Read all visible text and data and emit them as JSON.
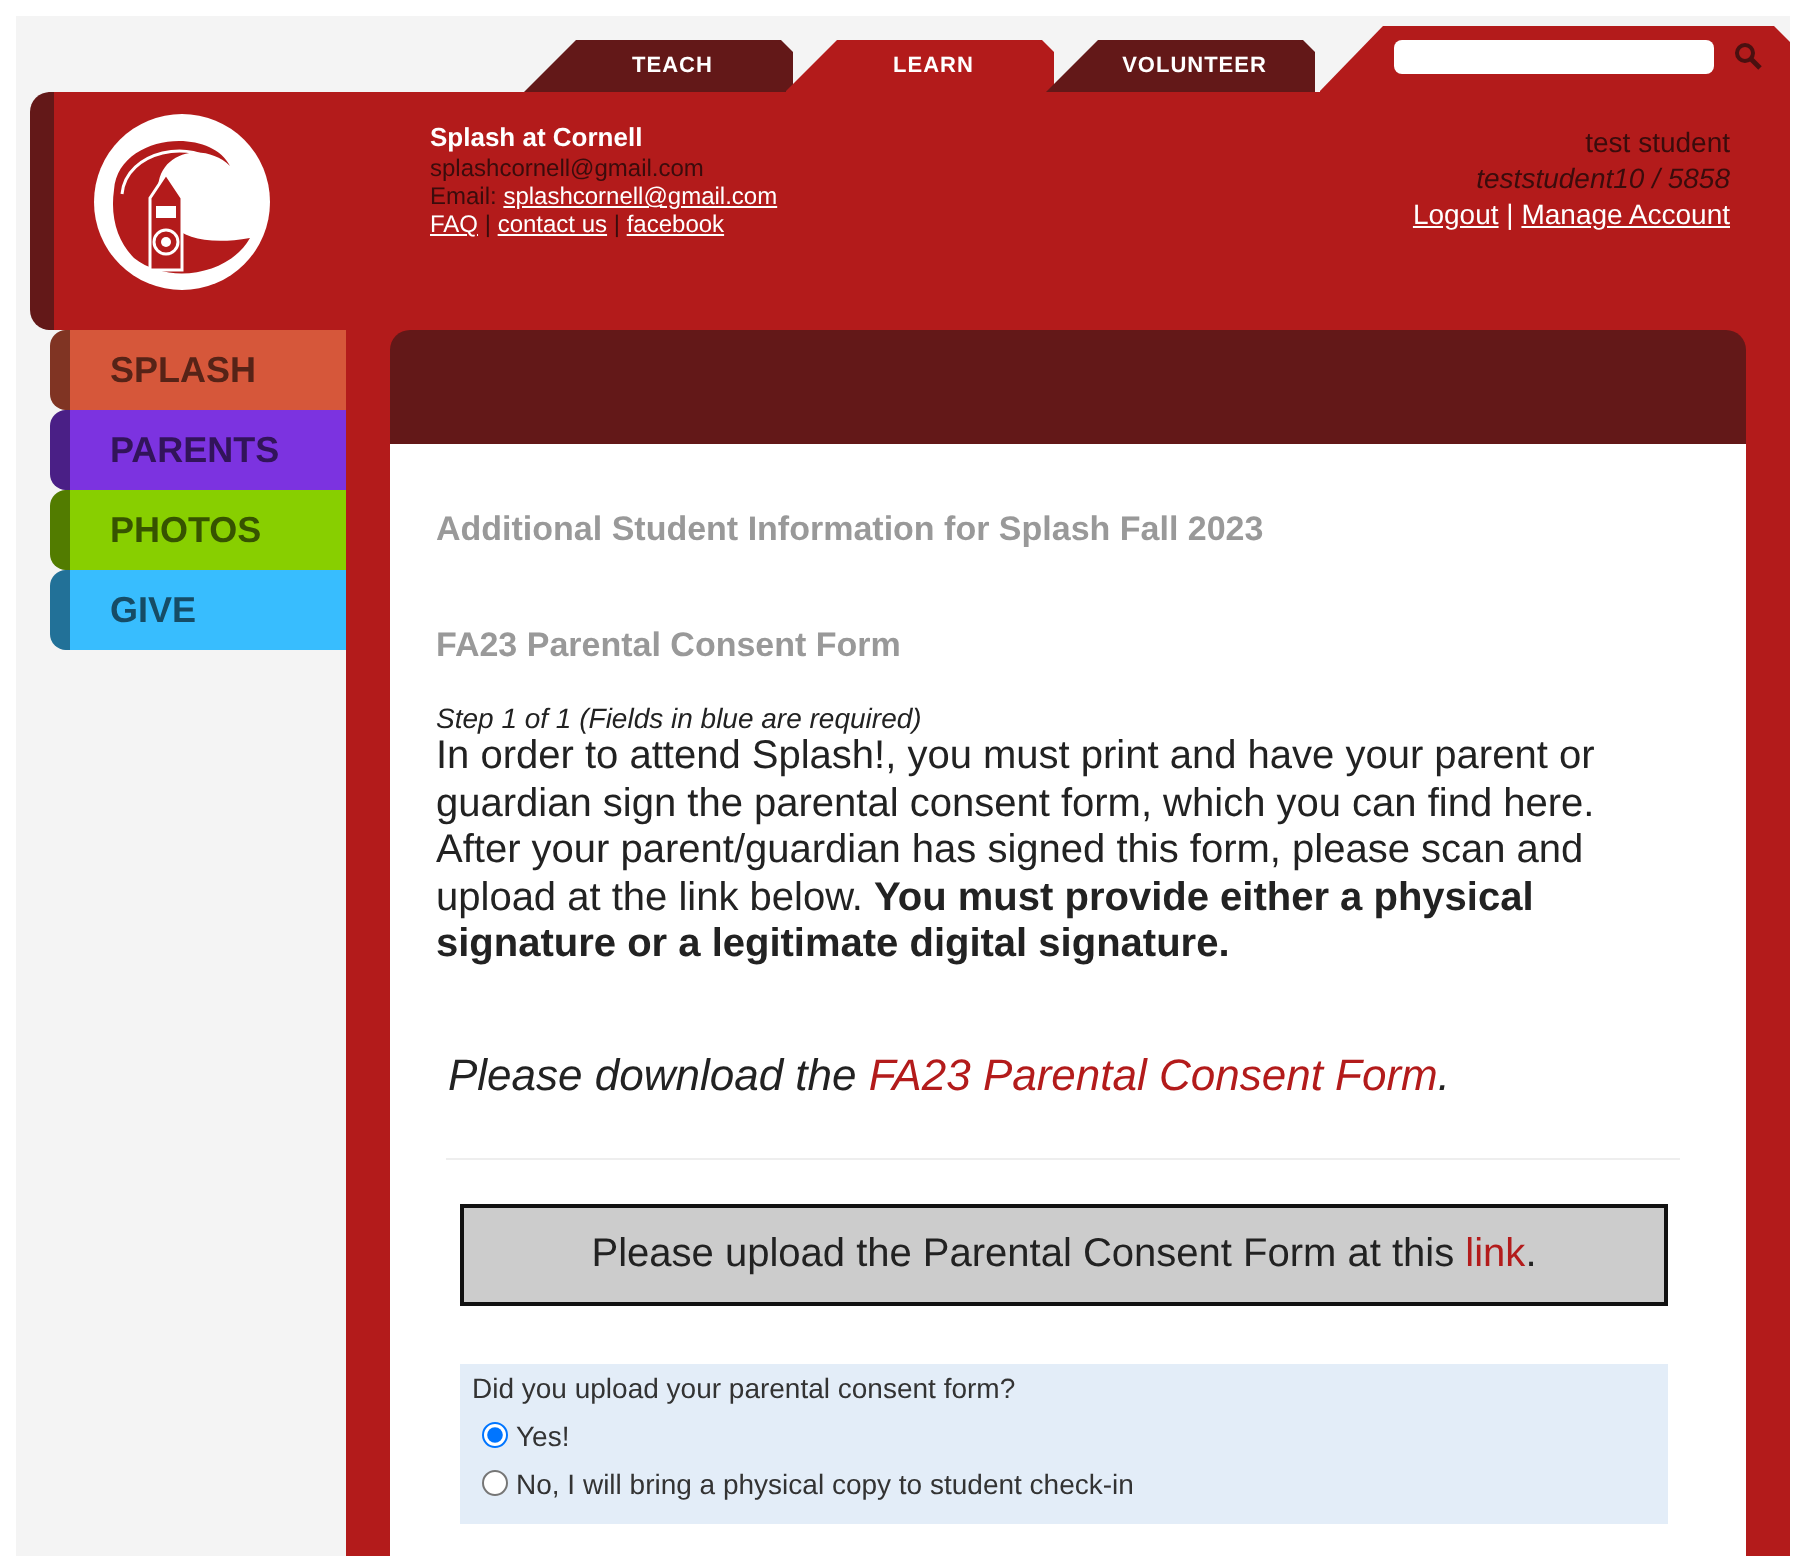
{
  "top_tabs": [
    {
      "label": "TEACH",
      "selected": false
    },
    {
      "label": "LEARN",
      "selected": true
    },
    {
      "label": "VOLUNTEER",
      "selected": false
    }
  ],
  "site": {
    "title": "Splash at Cornell",
    "email_plain": "splashcornell@gmail.com",
    "email_label": "Email:",
    "email_link": "splashcornell@gmail.com",
    "links": [
      "FAQ",
      "contact us",
      "facebook"
    ],
    "separator": "|"
  },
  "user": {
    "name": "test student",
    "account": "teststudent10 / 5858",
    "links": [
      "Logout",
      "Manage Account"
    ],
    "separator": "|"
  },
  "sidebar": {
    "items": [
      {
        "label": "SPLASH",
        "color": "#d6573a"
      },
      {
        "label": "PARENTS",
        "color": "#7c33e0"
      },
      {
        "label": "PHOTOS",
        "color": "#88cf00"
      },
      {
        "label": "GIVE",
        "color": "#38bdfe"
      }
    ]
  },
  "content": {
    "heading": "Additional Student Information for Splash Fall 2023",
    "form_title": "FA23 Parental Consent Form",
    "step": "Step 1 of 1 (Fields in blue are required)",
    "instructions": "In order to attend Splash!, you must print and have your parent or guardian sign the parental consent form, which you can find here. After your parent/guardian has signed this form, please scan and upload at the link below. **You must provide either a physical signature or a legitimate digital signature.**",
    "download": {
      "before": "Please download the ",
      "link": "FA23 Parental Consent Form",
      "after": "."
    },
    "upload": {
      "before": "Please upload the Parental Consent Form at this ",
      "link": "link",
      "after": "."
    },
    "question": {
      "label": "Did you upload your parental consent form?",
      "options": [
        {
          "label": "Yes!",
          "selected": true
        },
        {
          "label": "No, I will bring a physical copy to student check-in",
          "selected": false
        }
      ]
    }
  }
}
